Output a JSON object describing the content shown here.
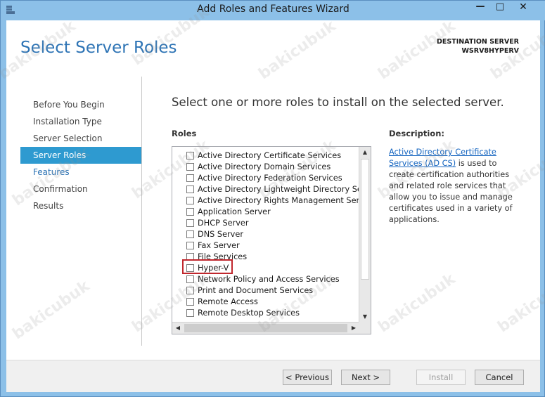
{
  "window": {
    "title": "Add Roles and Features Wizard",
    "minimize_glyph": "—",
    "maximize_glyph": "□",
    "close_glyph": "✕"
  },
  "page": {
    "title": "Select Server Roles",
    "destination_label": "DESTINATION SERVER",
    "destination_server": "WSRV8HYPERV",
    "heading": "Select one or more roles to install on the selected server."
  },
  "nav": {
    "items": [
      {
        "label": "Before You Begin"
      },
      {
        "label": "Installation Type"
      },
      {
        "label": "Server Selection"
      },
      {
        "label": "Server Roles"
      },
      {
        "label": "Features"
      },
      {
        "label": "Confirmation"
      },
      {
        "label": "Results"
      }
    ],
    "active": "Server Roles"
  },
  "roles": {
    "label": "Roles",
    "items": [
      {
        "label": "Active Directory Certificate Services",
        "checked": false
      },
      {
        "label": "Active Directory Domain Services",
        "checked": false
      },
      {
        "label": "Active Directory Federation Services",
        "checked": false
      },
      {
        "label": "Active Directory Lightweight Directory Servi",
        "checked": false
      },
      {
        "label": "Active Directory Rights Management Service",
        "checked": false
      },
      {
        "label": "Application Server",
        "checked": false
      },
      {
        "label": "DHCP Server",
        "checked": false
      },
      {
        "label": "DNS Server",
        "checked": false
      },
      {
        "label": "Fax Server",
        "checked": false
      },
      {
        "label": "File Services",
        "checked": false
      },
      {
        "label": "Hyper-V",
        "checked": false
      },
      {
        "label": "Network Policy and Access Services",
        "checked": false
      },
      {
        "label": "Print and Document Services",
        "checked": false
      },
      {
        "label": "Remote Access",
        "checked": false
      },
      {
        "label": "Remote Desktop Services",
        "checked": false
      }
    ],
    "highlighted": "Hyper-V"
  },
  "description": {
    "label": "Description:",
    "link": "Active Directory Certificate Services (AD CS)",
    "text": " is used to create certification authorities and related role services that allow you to issue and manage certificates used in a variety of applications."
  },
  "buttons": {
    "previous": "< Previous",
    "next": "Next >",
    "install": "Install",
    "cancel": "Cancel"
  },
  "watermark": "bakicubuk",
  "colors": {
    "accent": "#2e74b5",
    "nav_active": "#2e9ad0",
    "highlight_border": "#c0272d",
    "titlebar": "#8cc0e8"
  }
}
